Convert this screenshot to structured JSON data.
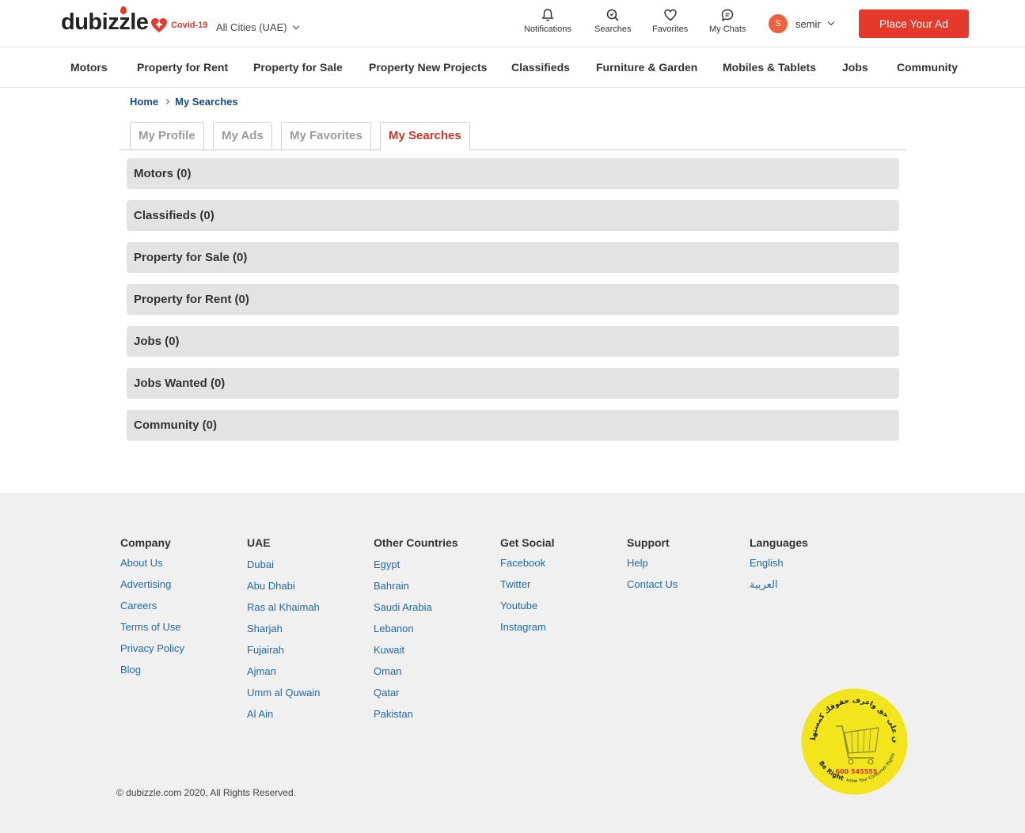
{
  "header": {
    "logo": "dubizzle",
    "covid_label": "Covid-19",
    "city": "All Cities (UAE)",
    "icons": [
      {
        "label": "Notifications",
        "icon": "bell-icon"
      },
      {
        "label": "Searches",
        "icon": "search-icon"
      },
      {
        "label": "Favorites",
        "icon": "heart-icon"
      },
      {
        "label": "My Chats",
        "icon": "chat-icon"
      }
    ],
    "user": {
      "initial": "S",
      "name": "semir"
    },
    "place_ad": "Place Your Ad",
    "colors": {
      "accent": "#e4392b",
      "link": "#1f6aa5"
    }
  },
  "nav": {
    "items": [
      "Motors",
      "Property for Rent",
      "Property for Sale",
      "Property New Projects",
      "Classifieds",
      "Furniture & Garden",
      "Mobiles & Tablets",
      "Jobs",
      "Community"
    ]
  },
  "breadcrumb": {
    "home": "Home",
    "current": "My Searches"
  },
  "tabs": [
    "My Profile",
    "My Ads",
    "My Favorites",
    "My Searches"
  ],
  "active_tab": "My Searches",
  "searches": [
    "Motors (0)",
    "Classifieds (0)",
    "Property for Sale (0)",
    "Property for Rent (0)",
    "Jobs (0)",
    "Jobs Wanted (0)",
    "Community (0)"
  ],
  "footer": {
    "columns": [
      {
        "title": "Company",
        "links": [
          "About Us",
          "Advertising",
          "Careers",
          "Terms of Use",
          "Privacy Policy",
          "Blog"
        ]
      },
      {
        "title": "UAE",
        "links": [
          "Dubai",
          "Abu Dhabi",
          "Ras al Khaimah",
          "Sharjah",
          "Fujairah",
          "Ajman",
          "Umm al Quwain",
          "Al Ain"
        ]
      },
      {
        "title": "Other Countries",
        "links": [
          "Egypt",
          "Bahrain",
          "Saudi Arabia",
          "Lebanon",
          "Kuwait",
          "Oman",
          "Qatar",
          "Pakistan"
        ]
      },
      {
        "title": "Get Social",
        "links": [
          "Facebook",
          "Twitter",
          "Youtube",
          "Instagram"
        ]
      },
      {
        "title": "Support",
        "links": [
          "Help",
          "Contact Us"
        ]
      },
      {
        "title": "Languages",
        "links": [
          "English",
          "العربية"
        ]
      }
    ],
    "copyright": "© dubizzle.com 2020, All Rights Reserved.",
    "badge": {
      "arabic": "كن على حق واعرف حقوقك كمستهلك",
      "english_top": "Be Right",
      "english_bottom": "know Your Consumer Rights",
      "phone": "600 545555",
      "color": "#f3e51c"
    }
  }
}
